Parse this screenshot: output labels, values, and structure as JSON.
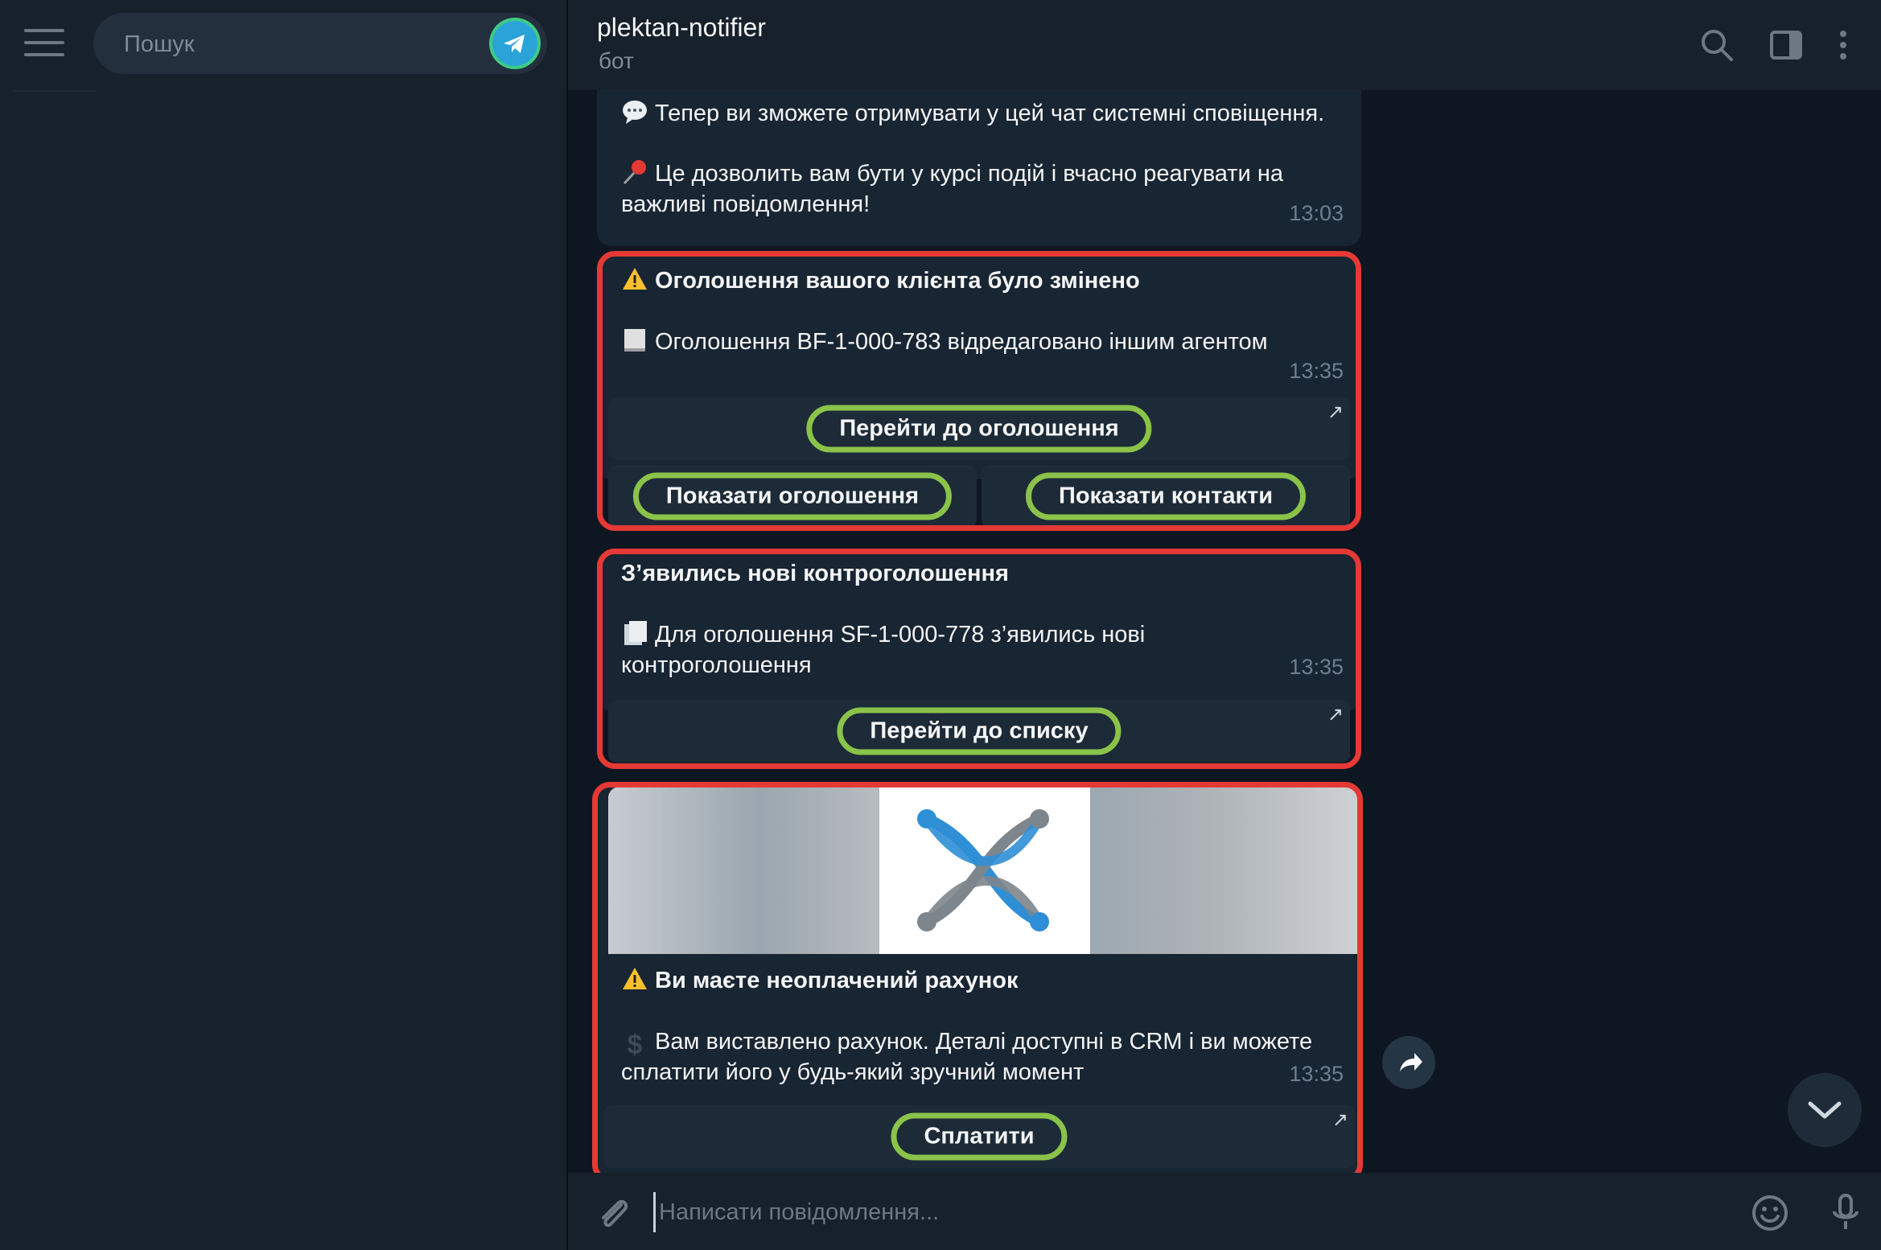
{
  "sidebar": {
    "search_placeholder": "Пошук"
  },
  "header": {
    "title": "plektan-notifier",
    "subtitle": "бот"
  },
  "messages": {
    "first": {
      "line1": "Тепер ви зможете отримувати у цей чат системні сповіщення.",
      "line2": "Це дозволить вам бути у курсі подій і вчасно реагувати на",
      "line3": "важливі повідомлення!",
      "time": "13:03"
    },
    "listing_changed": {
      "title": "Оголошення вашого клієнта було змінено",
      "body": "Оголошення BF-1-000-783 відредаговано іншим агентом",
      "time": "13:35",
      "button_go": "Перейти до оголошення",
      "button_show_listing": "Показати оголошення",
      "button_show_contacts": "Показати контакти"
    },
    "counter_offers": {
      "title": "З’явились нові контроголошення",
      "body_line1": "Для оголошення SF-1-000-778 з’явились нові",
      "body_line2": "контроголошення",
      "time": "13:35",
      "button_go_list": "Перейти до списку"
    },
    "invoice": {
      "title": "Ви маєте неоплачений рахунок",
      "body_line1": "Вам виставлено рахунок. Деталі доступні в CRM і ви можете",
      "body_line2": "сплатити його у будь-який зручний момент",
      "time": "13:35",
      "button_pay": "Сплатити"
    }
  },
  "composer": {
    "placeholder": "Написати повідомлення..."
  },
  "colors": {
    "highlight_red": "#e53935",
    "highlight_green": "#8bc34a",
    "bubble": "#182533",
    "chat_bg": "#0e1621"
  }
}
